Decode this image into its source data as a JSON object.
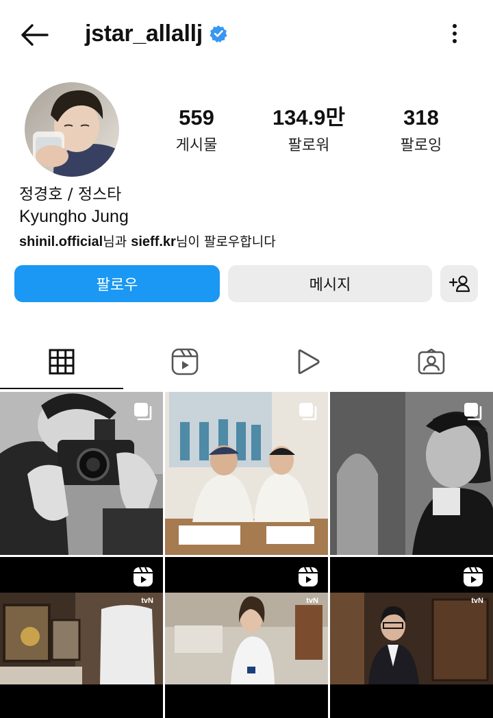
{
  "header": {
    "username": "jstar_allallj",
    "back_icon": "arrow-left-icon",
    "verified_icon": "verified-badge-icon",
    "more_icon": "more-vertical-icon",
    "verified_color": "#3897f0"
  },
  "profile": {
    "name": "정경호 / 정스타",
    "alt_name": "Kyungho Jung",
    "followed_by": {
      "user1": "shinil.official",
      "connector": "님과 ",
      "user2": "sieff.kr",
      "suffix": "님이 팔로우합니다"
    }
  },
  "stats": {
    "posts": {
      "value": "559",
      "label": "게시물"
    },
    "followers": {
      "value": "134.9만",
      "label": "팔로워"
    },
    "following": {
      "value": "318",
      "label": "팔로잉"
    }
  },
  "actions": {
    "follow_label": "팔로우",
    "message_label": "메시지",
    "suggest_icon": "add-person-icon",
    "follow_color": "#1a98f3"
  },
  "tabs": [
    {
      "icon": "grid-icon",
      "active": true
    },
    {
      "icon": "reels-icon",
      "active": false
    },
    {
      "icon": "play-icon",
      "active": false
    },
    {
      "icon": "tagged-icon",
      "active": false
    }
  ],
  "posts": [
    {
      "type": "carousel",
      "badge_icon": "carousel-icon"
    },
    {
      "type": "carousel",
      "badge_icon": "carousel-icon"
    },
    {
      "type": "carousel",
      "badge_icon": "carousel-icon"
    },
    {
      "type": "reel",
      "badge_icon": "reel-icon",
      "overlay_text": "tvN"
    },
    {
      "type": "reel",
      "badge_icon": "reel-icon",
      "overlay_text": "tvN"
    },
    {
      "type": "reel",
      "badge_icon": "reel-icon",
      "overlay_text": "tvN"
    }
  ]
}
